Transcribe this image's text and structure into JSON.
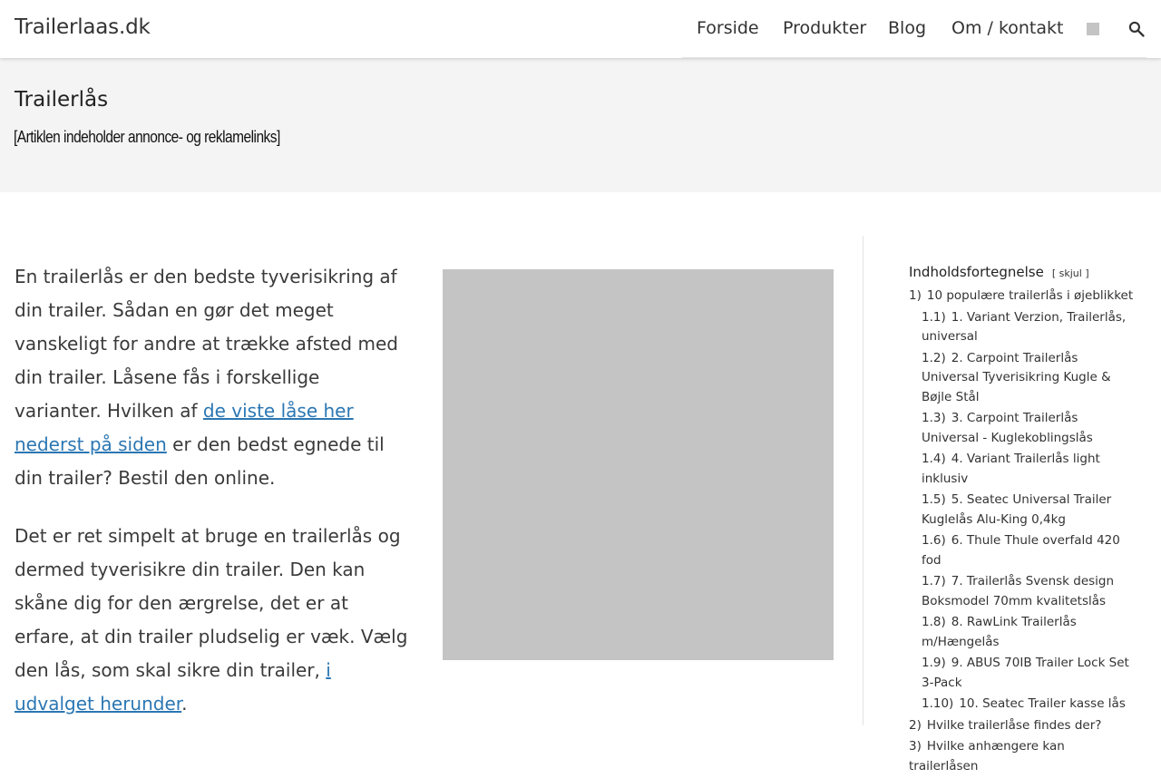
{
  "header": {
    "site_title": "Trailerlaas.dk",
    "nav": [
      "Forside",
      "Produkter",
      "Blog",
      "Om / kontakt"
    ],
    "search_icon": "search-icon"
  },
  "title_band": {
    "title": "Trailerlås",
    "disclaimer": "[Artiklen indeholder annonce- og reklamelinks]"
  },
  "intro": {
    "p1_before": "En trailerlås er den bedste tyverisikring af din trailer. Sådan en gør det meget vanskeligt for andre at trække afsted med din trailer. Låsene fås i forskellige varianter. Hvilken af ",
    "p1_link": "de viste låse her nederst på siden",
    "p1_after": " er den bedst egnede til din trailer? Bestil den online.",
    "p2_before": "Det er ret simpelt at bruge en trailerlås og dermed tyverisikre din trailer. Den kan skåne dig for den ærgrelse, det er at erfare, at din trailer pludselig er væk. Vælg den lås, som skal sikre din trailer, ",
    "p2_link": "i udvalget herunder",
    "p2_after": "."
  },
  "toc": {
    "title": "Indholdsfortegnelse",
    "toggle": "[ skjul ]",
    "items": [
      {
        "num": "1)",
        "label": "10 populære trailerlås i øjeblikket",
        "level": 1
      },
      {
        "num": "1.1)",
        "label": "1. Variant Verzion, Trailerlås, universal",
        "level": 2
      },
      {
        "num": "1.2)",
        "label": "2. Carpoint Trailerlås Universal Tyverisikring Kugle & Bøjle Stål",
        "level": 2
      },
      {
        "num": "1.3)",
        "label": "3. Carpoint Trailerlås Universal - Kuglekoblingslås",
        "level": 2
      },
      {
        "num": "1.4)",
        "label": "4. Variant Trailerlås light inklusiv",
        "level": 2
      },
      {
        "num": "1.5)",
        "label": "5. Seatec Universal Trailer Kuglelås Alu-King 0,4kg",
        "level": 2
      },
      {
        "num": "1.6)",
        "label": "6. Thule Thule overfald 420 fod",
        "level": 2
      },
      {
        "num": "1.7)",
        "label": "7. Trailerlås Svensk design Boksmodel 70mm kvalitetslås",
        "level": 2
      },
      {
        "num": "1.8)",
        "label": "8. RawLink Trailerlås m/Hængelås",
        "level": 2
      },
      {
        "num": "1.9)",
        "label": "9. ABUS 70IB Trailer Lock Set 3-Pack",
        "level": 2
      },
      {
        "num": "1.10)",
        "label": "10. Seatec Trailer kasse lås",
        "level": 2
      },
      {
        "num": "2)",
        "label": "Hvilke trailerlåse findes der?",
        "level": 1
      },
      {
        "num": "3)",
        "label": "Hvilke anhængere kan trailerlåsen",
        "level": 1
      }
    ]
  },
  "colors": {
    "link": "#2b77b3",
    "title_band_bg": "#f4f4f4",
    "placeholder": "#c4c4c4"
  }
}
